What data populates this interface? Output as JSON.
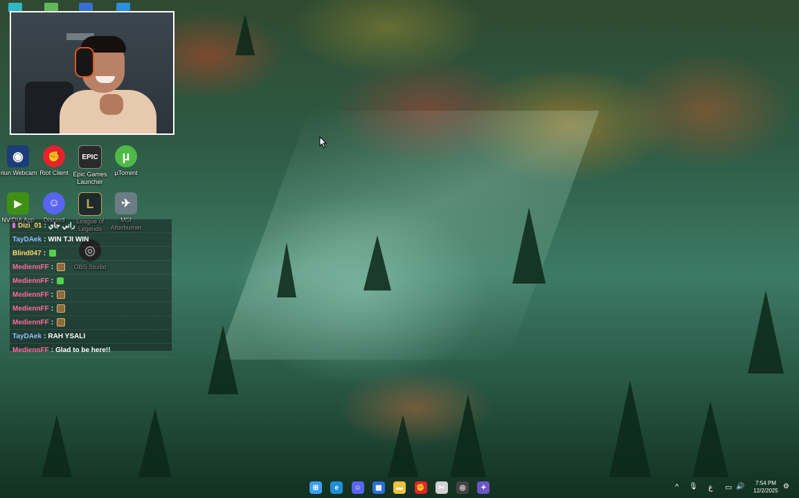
{
  "desktop": {
    "icons": [
      {
        "label": "Iriun Webcam",
        "name": "iriun-webcam-icon",
        "color": "#1b3e78",
        "glyph": "◉"
      },
      {
        "label": "Riot Client",
        "name": "riot-client-icon",
        "color": "#e3242b",
        "glyph": "✊"
      },
      {
        "label": "Epic Games Launcher",
        "name": "epic-games-icon",
        "color": "#2a2a2a",
        "glyph": "EPIC"
      },
      {
        "label": "µTorrent",
        "name": "utorrent-icon",
        "color": "#4fb946",
        "glyph": "μ"
      },
      {
        "label": "NVIDIA App",
        "name": "nvidia-app-icon",
        "color": "#3f8f15",
        "glyph": "▶"
      },
      {
        "label": "Discord",
        "name": "discord-icon",
        "color": "#5865f2",
        "glyph": "☺"
      },
      {
        "label": "League of Legends",
        "name": "league-of-legends-icon",
        "color": "#1d2a2e",
        "glyph": "L"
      },
      {
        "label": "MSI Afterburner",
        "name": "msi-afterburner-icon",
        "color": "#6b7c84",
        "glyph": "✈"
      },
      {
        "label": "OBS Studio",
        "name": "obs-studio-icon",
        "color": "#333333",
        "glyph": "◎"
      }
    ]
  },
  "chat": {
    "messages": [
      {
        "user": "Dizi_01",
        "color": "#ffd86e",
        "text": "راني جاي",
        "badge": true,
        "emote": ""
      },
      {
        "user": "TayDAek",
        "color": "#8fbfff",
        "text": "WIN TJI WIN",
        "badge": false,
        "emote": ""
      },
      {
        "user": "Blind047",
        "color": "#ffd86e",
        "text": "",
        "badge": false,
        "emote": "green"
      },
      {
        "user": "MediennFF",
        "color": "#ff6a9c",
        "text": "",
        "badge": false,
        "emote": "bag"
      },
      {
        "user": "MediennFF",
        "color": "#ff6a9c",
        "text": "",
        "badge": false,
        "emote": "green"
      },
      {
        "user": "MediennFF",
        "color": "#ff6a9c",
        "text": "",
        "badge": false,
        "emote": "bag"
      },
      {
        "user": "MediennFF",
        "color": "#ff6a9c",
        "text": "",
        "badge": false,
        "emote": "bag"
      },
      {
        "user": "MediennFF",
        "color": "#ff6a9c",
        "text": "",
        "badge": false,
        "emote": "bag"
      },
      {
        "user": "TayDAek",
        "color": "#8fbfff",
        "text": "RAH YSALI",
        "badge": false,
        "emote": ""
      },
      {
        "user": "MediennFF",
        "color": "#ff6a9c",
        "text": "Glad to be here!!",
        "badge": false,
        "emote": ""
      }
    ],
    "separator": ":"
  },
  "taskbar": {
    "apps": [
      {
        "name": "start-button",
        "color": "#3aa0ff",
        "glyph": "⊞"
      },
      {
        "name": "edge-icon",
        "color": "#1f8fd6",
        "glyph": "e"
      },
      {
        "name": "discord-taskbar-icon",
        "color": "#5865f2",
        "glyph": "☺"
      },
      {
        "name": "store-icon",
        "color": "#2b6fd6",
        "glyph": "▦"
      },
      {
        "name": "file-explorer-icon",
        "color": "#f2c23a",
        "glyph": "▬"
      },
      {
        "name": "riot-taskbar-icon",
        "color": "#e3242b",
        "glyph": "✊"
      },
      {
        "name": "snipping-tool-icon",
        "color": "#d2d2d2",
        "glyph": "✂"
      },
      {
        "name": "obs-taskbar-icon",
        "color": "#444444",
        "glyph": "◎"
      },
      {
        "name": "chatgpt-icon",
        "color": "#6b57c6",
        "glyph": "✦"
      }
    ],
    "tray": {
      "show_hidden": "^",
      "mic": "🎙",
      "language": "ع",
      "network": "▭",
      "volume": "🔊",
      "time": "7:54 PM",
      "date": "12/2/2025"
    }
  }
}
